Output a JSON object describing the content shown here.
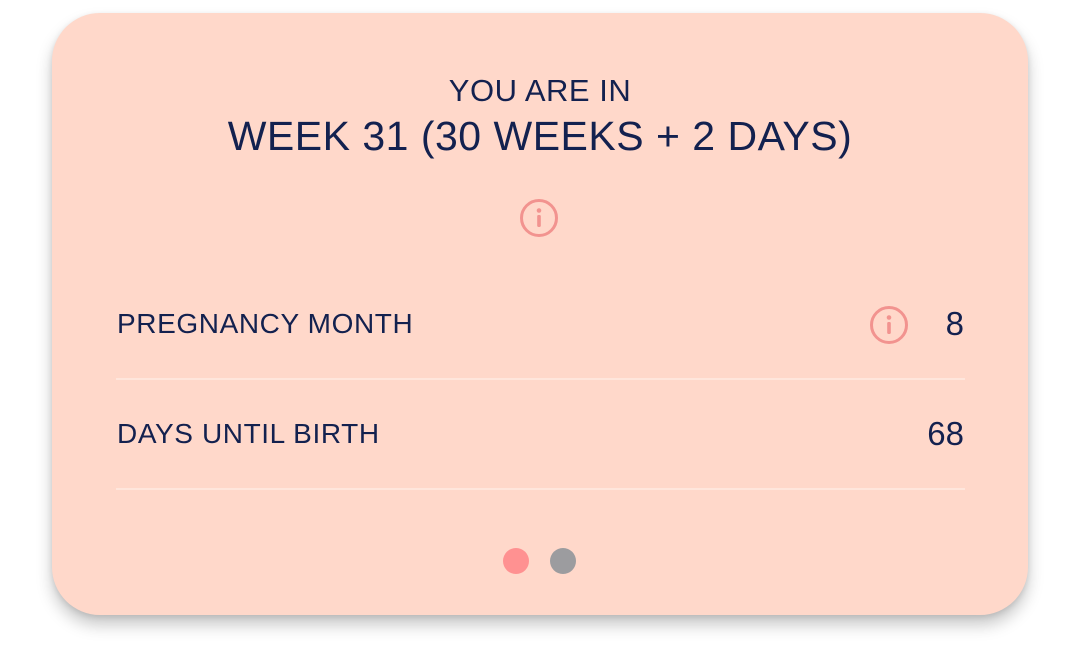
{
  "status": {
    "intro": "YOU ARE IN",
    "headline": "WEEK 31 (30 WEEKS + 2 DAYS)"
  },
  "rows": [
    {
      "label": "PREGNANCY MONTH",
      "value": "8",
      "has_info": true
    },
    {
      "label": "DAYS UNTIL BIRTH",
      "value": "68",
      "has_info": false
    }
  ],
  "pager": {
    "total": 2,
    "active_index": 0
  },
  "colors": {
    "card_background": "#ffd8ca",
    "text": "#13214f",
    "accent": "#f2938f",
    "dot_active": "#ff9191",
    "dot_inactive": "#9c9c9f"
  },
  "icons": {
    "info": "info-circle-icon"
  }
}
